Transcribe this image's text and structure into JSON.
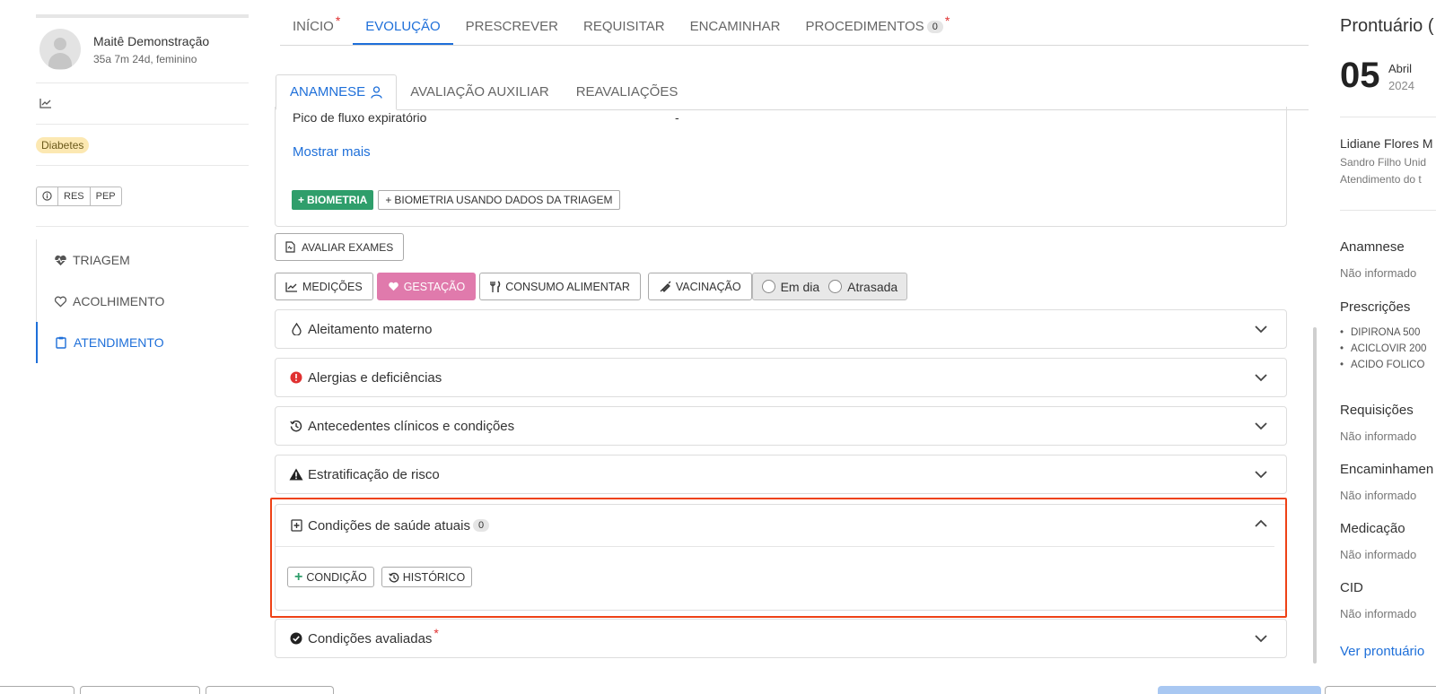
{
  "patient": {
    "name": "Maitê Demonstração",
    "desc": "35a 7m 24d, feminino",
    "tag": "Diabetes",
    "buttons": [
      "RES",
      "PEP"
    ],
    "menu": [
      {
        "label": "TRIAGEM",
        "icon": "heartbeat-icon",
        "active": false
      },
      {
        "label": "ACOLHIMENTO",
        "icon": "heart-outline-icon",
        "active": false
      },
      {
        "label": "ATENDIMENTO",
        "icon": "clipboard-icon",
        "active": true
      }
    ]
  },
  "main_tabs": [
    {
      "label": "INÍCIO",
      "required": true
    },
    {
      "label": "EVOLUÇÃO",
      "active": true
    },
    {
      "label": "PRESCREVER"
    },
    {
      "label": "REQUISITAR"
    },
    {
      "label": "ENCAMINHAR"
    },
    {
      "label": "PROCEDIMENTOS",
      "count": "0",
      "required": true
    }
  ],
  "sub_tabs": [
    {
      "label": "ANAMNESE",
      "active": true
    },
    {
      "label": "AVALIAÇÃO AUXILIAR"
    },
    {
      "label": "REAVALIAÇÕES"
    }
  ],
  "biometria": {
    "pico_label": "Pico de fluxo expiratório",
    "pico_value": "-",
    "mostrar_mais": "Mostrar mais",
    "btn_biometria": "BIOMETRIA",
    "btn_triagem": "BIOMETRIA USANDO DADOS DA TRIAGEM"
  },
  "avaliar_exames": "AVALIAR EXAMES",
  "toolbar": {
    "medicoes": "MEDIÇÕES",
    "gestacao": "GESTAÇÃO",
    "consumo": "CONSUMO ALIMENTAR",
    "vacinacao": "VACINAÇÃO",
    "em_dia": "Em dia",
    "atrasada": "Atrasada"
  },
  "accordions": [
    {
      "label": "Aleitamento materno",
      "icon": "drop-icon"
    },
    {
      "label": "Alergias e deficiências",
      "icon": "alert-circle-icon"
    },
    {
      "label": "Antecedentes clínicos e condições",
      "icon": "history-icon"
    },
    {
      "label": "Estratificação de risco",
      "icon": "warning-icon"
    }
  ],
  "condicoes_atuais": {
    "label": "Condições de saúde atuais",
    "count": "0",
    "btn_condicao": "CONDIÇÃO",
    "btn_historico": "HISTÓRICO"
  },
  "condicoes_avaliadas": {
    "label": "Condições avaliadas",
    "required": true
  },
  "summary": {
    "title": "Prontuário (",
    "day": "05",
    "month": "Abril",
    "year": "2024",
    "doctor": "Lidiane Flores M",
    "unit": "Sandro Filho Unid",
    "atendimento": "Atendimento do t",
    "sections": [
      {
        "label": "Anamnese",
        "value": "Não informado"
      },
      {
        "label": "Prescrições",
        "items": [
          "DIPIRONA 500",
          "ACICLOVIR 200",
          "ACIDO FOLICO"
        ]
      },
      {
        "label": "Requisições",
        "value": "Não informado"
      },
      {
        "label": "Encaminhamen",
        "value": "Não informado"
      },
      {
        "label": "Medicação",
        "value": "Não informado"
      },
      {
        "label": "CID",
        "value": "Não informado"
      }
    ],
    "link": "Ver prontuário"
  },
  "colors": {
    "accent": "#1e6fd9",
    "highlight": "#ee4216",
    "green": "#2f9e6b",
    "pink": "#e07aac",
    "tag": "#fce8b2"
  }
}
